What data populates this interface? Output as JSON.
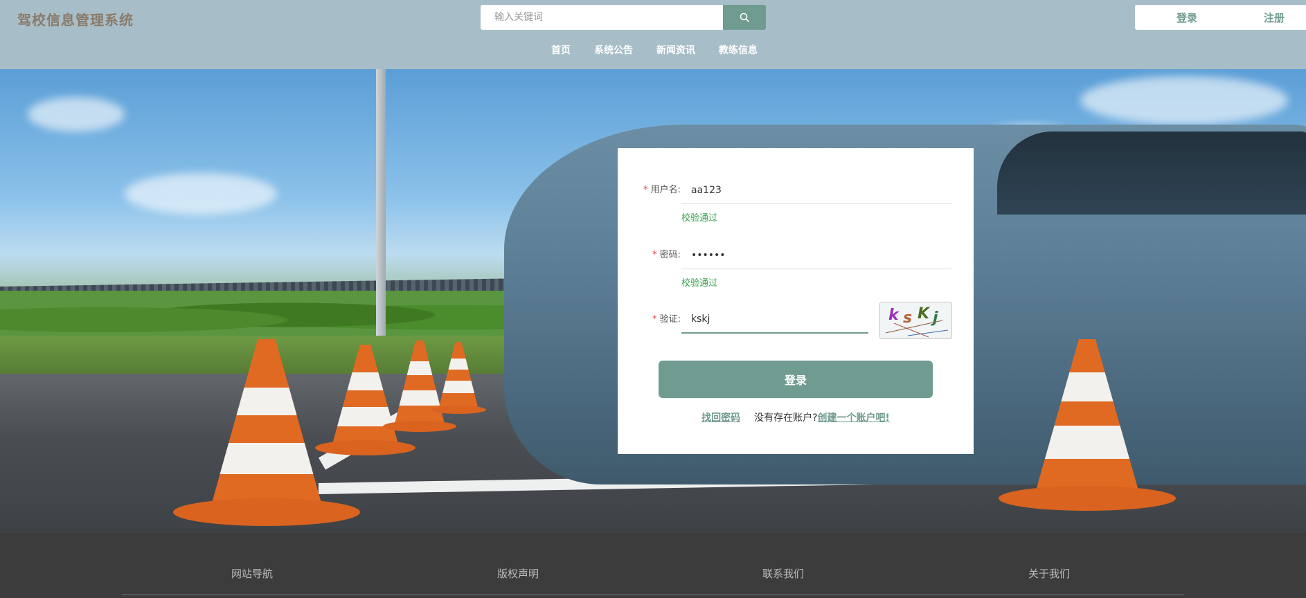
{
  "header": {
    "brand": "驾校信息管理系统",
    "search_placeholder": "输入关键词",
    "login_label": "登录",
    "register_label": "注册"
  },
  "nav": [
    "首页",
    "系统公告",
    "新闻资讯",
    "教练信息"
  ],
  "login_form": {
    "username_label": "用户名:",
    "username_value": "aa123",
    "username_hint": "校验通过",
    "password_label": "密码:",
    "password_value": "••••••",
    "password_hint": "校验通过",
    "captcha_label": "验证:",
    "captcha_value": "kskj",
    "captcha_image_text": "ksKj",
    "submit_label": "登录",
    "forgot_label": "找回密码",
    "no_account_text": "没有存在账户?",
    "create_account_label": "创建一个账户吧!"
  },
  "footer": [
    "网站导航",
    "版权声明",
    "联系我们",
    "关于我们"
  ],
  "colors": {
    "accent": "#6f9b90",
    "header_bg": "#a7bec8",
    "valid_green": "#3aa14c",
    "footer_bg": "#3c3c3c"
  }
}
